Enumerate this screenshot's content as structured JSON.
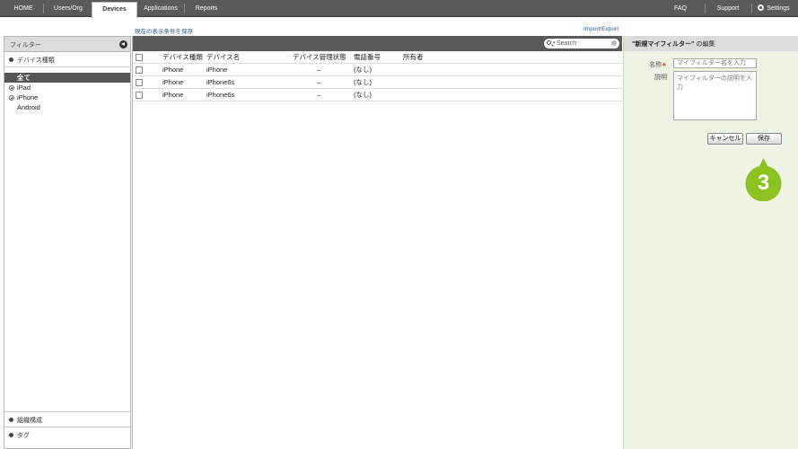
{
  "nav": {
    "tabs": [
      {
        "label": "HOME"
      },
      {
        "label": "Users/Org"
      },
      {
        "label": "Devices",
        "active": true
      },
      {
        "label": "Applications"
      },
      {
        "label": "Reports"
      }
    ],
    "right": [
      {
        "label": "FAQ"
      },
      {
        "label": "Support"
      },
      {
        "label": "Settings",
        "icon": "gear-icon"
      }
    ]
  },
  "links": {
    "save_conditions": "現在の表示条件を保存",
    "import_export": "Import/Export"
  },
  "sidebar": {
    "title": "フィルター",
    "section": "デバイス種類",
    "tree": [
      {
        "label": "全て",
        "selected": true,
        "expandable": false
      },
      {
        "label": "iPad",
        "selected": false,
        "expandable": true
      },
      {
        "label": "iPhone",
        "selected": false,
        "expandable": true
      },
      {
        "label": "Android",
        "selected": false,
        "expandable": false
      }
    ],
    "bottom": [
      {
        "label": "組織構成"
      },
      {
        "label": "タグ"
      }
    ]
  },
  "grid": {
    "search_placeholder": "Search",
    "columns": [
      "デバイス種類",
      "デバイス名",
      "デバイス管理状態",
      "電話番号",
      "所有者"
    ],
    "rows": [
      [
        "iPhone",
        "iPhone",
        "–",
        "(なし)",
        ""
      ],
      [
        "iPhone",
        "iPhone6s",
        "–",
        "(なし)",
        ""
      ],
      [
        "iPhone",
        "iPhone6s",
        "–",
        "(なし)",
        ""
      ]
    ]
  },
  "panel": {
    "title_quoted": "\"新規マイフィルター\"",
    "title_suffix": " の編集",
    "name_label": "名称",
    "required_mark": "∗",
    "name_placeholder": "マイフィルター名を入力",
    "desc_label": "説明",
    "desc_placeholder": "マイフィルターの説明を入力",
    "cancel_label": "キャンセル",
    "save_label": "保存"
  },
  "callout": {
    "number": "3",
    "color": "#8cc21f"
  },
  "colors": {
    "nav_bg": "#5a5a5a",
    "link": "#2a5a9a",
    "panel_bg": "#eef4e4"
  }
}
